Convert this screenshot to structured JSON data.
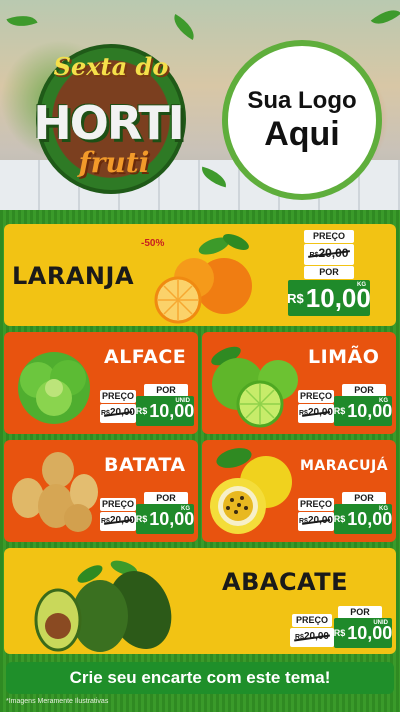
{
  "header": {
    "title_line1": "Sexta do",
    "title_line2": "HORTI",
    "title_line3": "fruti",
    "logo_line1": "Sua Logo",
    "logo_line2": "Aqui"
  },
  "products": [
    {
      "name": "LARANJA",
      "discount": "-50%",
      "price_label": "PREÇO",
      "old_currency": "R$",
      "old_price": "20,00",
      "por_label": "POR",
      "currency": "R$",
      "new_price": "10,00",
      "unit": "KG",
      "fruit_icon": "orange-icon"
    },
    {
      "name": "ALFACE",
      "price_label": "PREÇO",
      "old_currency": "R$",
      "old_price": "20,00",
      "por_label": "POR",
      "currency": "R$",
      "new_price": "10,00",
      "unit": "UNID",
      "fruit_icon": "lettuce-icon"
    },
    {
      "name": "LIMÃO",
      "price_label": "PREÇO",
      "old_currency": "R$",
      "old_price": "20,00",
      "por_label": "POR",
      "currency": "R$",
      "new_price": "10,00",
      "unit": "KG",
      "fruit_icon": "lime-icon"
    },
    {
      "name": "BATATA",
      "price_label": "PREÇO",
      "old_currency": "R$",
      "old_price": "20,00",
      "por_label": "POR",
      "currency": "R$",
      "new_price": "10,00",
      "unit": "KG",
      "fruit_icon": "potato-icon"
    },
    {
      "name": "MARACUJÁ",
      "price_label": "PREÇO",
      "old_currency": "R$",
      "old_price": "20,00",
      "por_label": "POR",
      "currency": "R$",
      "new_price": "10,00",
      "unit": "KG",
      "fruit_icon": "passion-fruit-icon"
    },
    {
      "name": "ABACATE",
      "price_label": "PREÇO",
      "old_currency": "R$",
      "old_price": "20,00",
      "por_label": "POR",
      "currency": "R$",
      "new_price": "10,00",
      "unit": "UNID",
      "fruit_icon": "avocado-icon"
    }
  ],
  "banner": {
    "text": "Crie seu encarte com este tema!"
  },
  "footnote": "*Imagens Meramente Ilustrativas",
  "colors": {
    "yellow_card": "#f2c314",
    "orange_card": "#e8530f",
    "green_price": "#1f8a2a",
    "grass": "#3a9a2a"
  }
}
